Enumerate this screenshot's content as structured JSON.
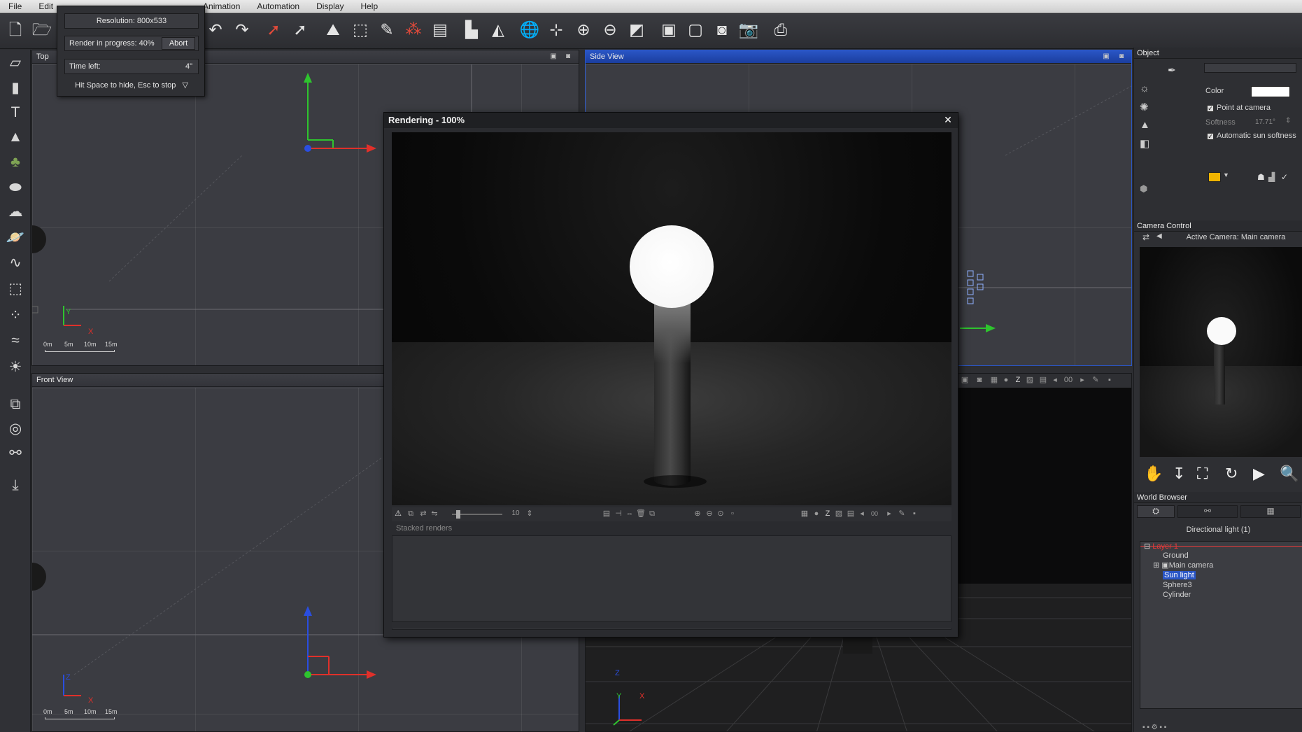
{
  "menu": [
    "File",
    "Edit",
    "Animation",
    "Automation",
    "Display",
    "Help"
  ],
  "render_progress": {
    "resolution": "Resolution: 800x533",
    "progress_text": "Render in progress: 40%",
    "progress_percent": 40,
    "abort_label": "Abort",
    "time_left_label": "Time left:",
    "time_left_value": "4\"",
    "hint": "Hit Space to hide, Esc to stop"
  },
  "viewports": {
    "top": {
      "title": "Top",
      "scale": [
        "0m",
        "5m",
        "10m",
        "15m"
      ],
      "axes": [
        "Y",
        "X"
      ]
    },
    "front": {
      "title": "Front View",
      "scale": [
        "0m",
        "5m",
        "10m",
        "15m"
      ],
      "axes": [
        "Z",
        "X"
      ]
    },
    "side": {
      "title": "Side View"
    },
    "camera": {
      "axes": [
        "Z",
        "Y",
        "X"
      ],
      "counter": "00"
    }
  },
  "render_window": {
    "title": "Rendering - 100%",
    "close_glyph": "✕",
    "stack_count": "10",
    "frame": "00",
    "stacked_label": "Stacked renders"
  },
  "object_panel": {
    "title": "Object",
    "color_label": "Color",
    "color_value": "#ffffff",
    "point_at_camera": "Point at camera",
    "softness_label": "Softness",
    "softness_value": "17.71°",
    "auto_softness": "Automatic sun softness",
    "swatch_color": "#f0b400"
  },
  "camera_control": {
    "title": "Camera Control",
    "active_camera": "Active Camera: Main camera"
  },
  "world_browser": {
    "title": "World Browser",
    "subtitle": "Directional light (1)",
    "tree": [
      {
        "label": "Layer 1"
      },
      {
        "label": "Ground"
      },
      {
        "label": "Main camera"
      },
      {
        "label": "Sun light"
      },
      {
        "label": "Sphere3"
      },
      {
        "label": "Cylinder"
      }
    ]
  },
  "colors": {
    "accent": "#2a56c6",
    "axis_x": "#e0302a",
    "axis_y": "#2ec42e",
    "axis_z": "#2a4ee0"
  }
}
